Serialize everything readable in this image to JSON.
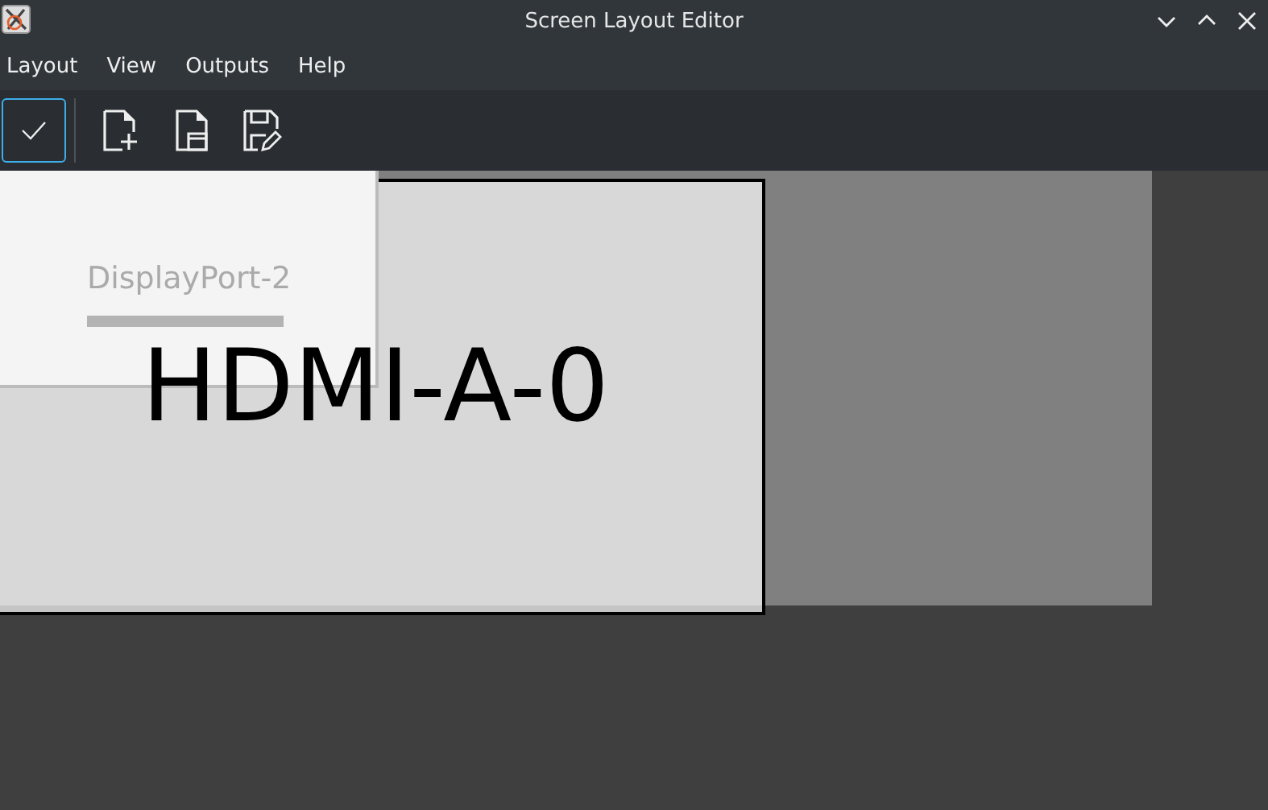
{
  "window": {
    "title": "Screen Layout Editor"
  },
  "menu": [
    "Layout",
    "View",
    "Outputs",
    "Help"
  ],
  "apply_button": {
    "checked": true
  },
  "toolbar": [
    {
      "kind": "new"
    },
    {
      "kind": "open"
    },
    {
      "kind": "save"
    }
  ],
  "outputs": [
    {
      "name": "HDMI-A-0",
      "selected": true
    },
    {
      "name": "DisplayPort-2",
      "selected": false
    }
  ]
}
